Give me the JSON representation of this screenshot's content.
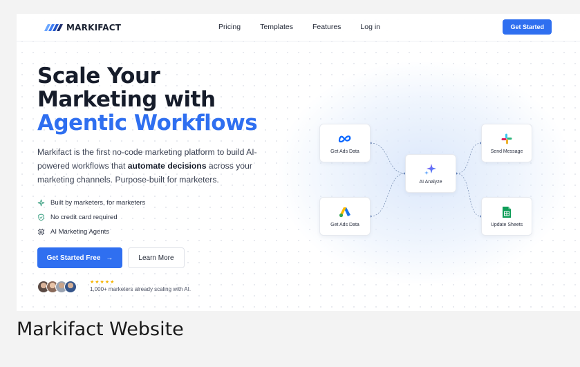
{
  "brand": {
    "name": "MARKIFACT",
    "accent": "#2f6ff0"
  },
  "nav": {
    "links": [
      "Pricing",
      "Templates",
      "Features",
      "Log in"
    ],
    "cta": "Get Started"
  },
  "hero": {
    "title_line1": "Scale Your",
    "title_line2": "Marketing with",
    "title_line3": "Agentic Workflows",
    "desc_part1": "Markifact is the first no-code marketing platform to build AI-powered workflows that ",
    "desc_bold": "automate decisions",
    "desc_part2": " across your marketing channels. Purpose-built for marketers.",
    "features": [
      {
        "icon": "sparkle-icon",
        "label": "Built by marketers, for marketers"
      },
      {
        "icon": "shield-check-icon",
        "label": "No credit card required"
      },
      {
        "icon": "chip-icon",
        "label": "AI Marketing Agents"
      }
    ],
    "primary_cta": "Get Started Free",
    "primary_cta_arrow": "→",
    "secondary_cta": "Learn More",
    "stars": "★★★★★",
    "social_proof": "1,000+ marketers already scaling with AI."
  },
  "workflow": {
    "nodes": {
      "meta": {
        "label": "Get Ads Data",
        "icon": "meta-icon"
      },
      "google": {
        "label": "Get Ads Data",
        "icon": "google-ads-icon"
      },
      "ai": {
        "label": "AI Analyze",
        "icon": "ai-sparkle-icon"
      },
      "slack": {
        "label": "Send Message",
        "icon": "slack-icon"
      },
      "sheets": {
        "label": "Update Sheets",
        "icon": "sheets-icon"
      }
    }
  },
  "caption": "Markifact Website"
}
